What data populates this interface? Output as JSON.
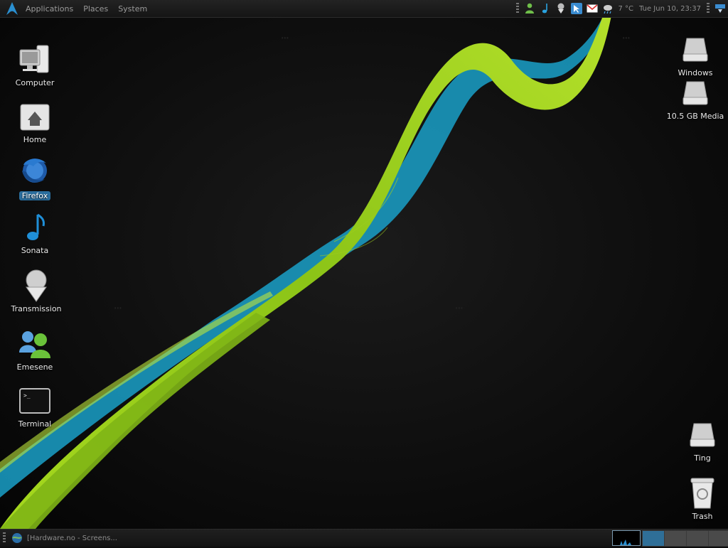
{
  "top_panel": {
    "menus": {
      "applications": "Applications",
      "places": "Places",
      "system": "System"
    },
    "tray": {
      "temperature": "7 °C",
      "clock": "Tue Jun 10, 23:37",
      "icons": [
        "user-icon",
        "music-note-icon",
        "download-icon",
        "cursor-icon",
        "gmail-icon",
        "weather-icon",
        "network-icon"
      ]
    }
  },
  "desktop": {
    "left_icons": {
      "computer": "Computer",
      "home": "Home",
      "firefox": "Firefox",
      "sonata": "Sonata",
      "transmission": "Transmission",
      "emesene": "Emesene",
      "terminal": "Terminal"
    },
    "right_icons": {
      "windows": "Windows",
      "media": "10.5 GB Media",
      "ting": "Ting",
      "trash": "Trash"
    },
    "selected": "firefox"
  },
  "bottom_panel": {
    "task_title": "[Hardware.no - Screens...",
    "workspaces": 4,
    "active_workspace": 1
  },
  "colors": {
    "accent": "#2f6f98",
    "ribbon_green": "#8fcc1c",
    "ribbon_cyan": "#1aa0c8"
  }
}
